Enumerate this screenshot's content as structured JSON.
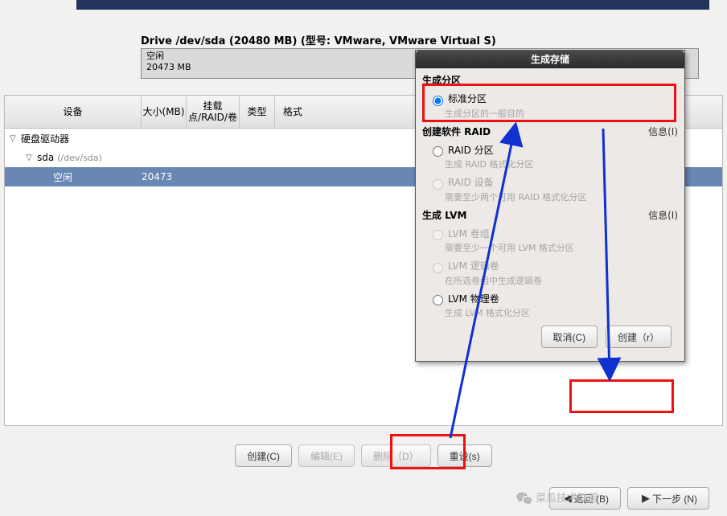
{
  "drive": {
    "header": "Drive /dev/sda (20480 MB) (型号: VMware, VMware Virtual S)",
    "free_label": "空闲",
    "free_size": "20473 MB"
  },
  "columns": {
    "device": "设备",
    "size": "大小(MB)",
    "mount": "挂载点/RAID/卷",
    "type": "类型",
    "format": "格式"
  },
  "tree": {
    "group": "硬盘驱动器",
    "disk": "sda",
    "disk_path": "(/dev/sda)",
    "free": "空闲",
    "free_size": "20473"
  },
  "buttons": {
    "create": "创建(C)",
    "edit": "编辑(E)",
    "delete": "删除（D）",
    "reset": "重设(s)",
    "back": "返回 (B)",
    "next": "下一步 (N)"
  },
  "dialog": {
    "title": "生成存储",
    "section_partition": "生成分区",
    "opt_standard": "标准分区",
    "opt_standard_desc": "生成分区的一般目的",
    "section_raid": "创建软件 RAID",
    "info": "信息(I)",
    "opt_raid_part": "RAID 分区",
    "opt_raid_part_desc": "生成 RAID 格式化分区",
    "opt_raid_dev": "RAID 设备",
    "opt_raid_dev_desc": "需要至少两个可用 RAID 格式化分区",
    "section_lvm": "生成 LVM",
    "opt_lvm_vg": "LVM 卷组",
    "opt_lvm_vg_desc": "需要至少一个可用 LVM 格式分区",
    "opt_lvm_lv": "LVM 逻辑卷",
    "opt_lvm_lv_desc": "在所选卷组中生成逻辑卷",
    "opt_lvm_pv": "LVM 物理卷",
    "opt_lvm_pv_desc": "生成 LVM 格式化分区",
    "cancel": "取消(C)",
    "create": "创建（r）"
  },
  "watermark": "菜瓜技术联盟"
}
